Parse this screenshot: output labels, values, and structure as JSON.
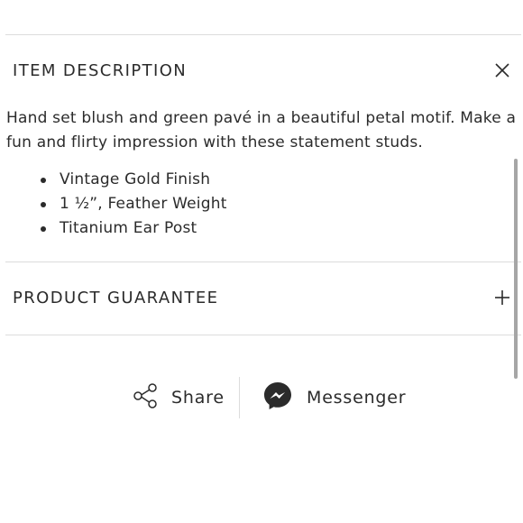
{
  "sections": [
    {
      "title": "ITEM DESCRIPTION",
      "expanded": true,
      "toggle_icon": "close-icon"
    },
    {
      "title": "PRODUCT GUARANTEE",
      "expanded": false,
      "toggle_icon": "plus-icon"
    }
  ],
  "description": {
    "text": "Hand set blush and green pavé in a beautiful petal motif. Make a fun and flirty impression with these statement studs.",
    "features": [
      "Vintage Gold Finish",
      "1 ½”, Feather Weight",
      "Titanium Ear Post"
    ]
  },
  "share": {
    "share_label": "Share",
    "share_icon": "share-icon",
    "messenger_label": "Messenger",
    "messenger_icon": "messenger-icon"
  },
  "colors": {
    "text": "#2b2b2b",
    "divider": "#dcdcdc",
    "messenger_bubble": "#2b2b2b",
    "scrollbar": "#a6a6a6"
  }
}
